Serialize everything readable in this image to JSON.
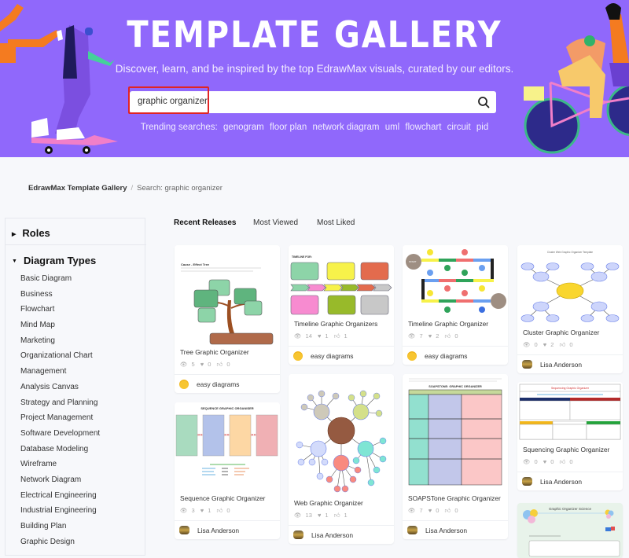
{
  "hero": {
    "title": "TEMPLATE GALLERY",
    "subtitle": "Discover, learn, and be inspired by the top EdrawMax visuals, curated by our editors.",
    "search_value": "graphic organizer",
    "search_icon": "search-icon",
    "trending_label": "Trending searches:",
    "trending": [
      "genogram",
      "floor plan",
      "network diagram",
      "uml",
      "flowchart",
      "circuit",
      "pid"
    ],
    "bg_color": "#9068fb"
  },
  "breadcrumb": {
    "root": "EdrawMax Template Gallery",
    "separator": "/",
    "current": "Search:  graphic organizer"
  },
  "sidebar": {
    "roles_label": "Roles",
    "diagram_types_label": "Diagram Types",
    "items": [
      "Basic Diagram",
      "Business",
      "Flowchart",
      "Mind Map",
      "Marketing",
      "Organizational Chart",
      "Management",
      "Analysis Canvas",
      "Strategy and Planning",
      "Project Management",
      "Software Development",
      "Database Modeling",
      "Wireframe",
      "Network Diagram",
      "Electrical Engineering",
      "Industrial Engineering",
      "Building Plan",
      "Graphic Design"
    ]
  },
  "tabs": [
    {
      "label": "Recent Releases",
      "active": true
    },
    {
      "label": "Most Viewed",
      "active": false
    },
    {
      "label": "Most Liked",
      "active": false
    }
  ],
  "cards": [
    {
      "title": "Tree Graphic Organizer",
      "views": "5",
      "favorites": "0",
      "likes": "0",
      "author": "easy diagrams"
    },
    {
      "title": "Timeline Graphic Organizers",
      "views": "14",
      "favorites": "1",
      "likes": "1",
      "author": "easy diagrams"
    },
    {
      "title": "Timeline Graphic Organizer",
      "views": "7",
      "favorites": "2",
      "likes": "0",
      "author": "easy diagrams"
    },
    {
      "title": "Cluster Graphic Organizer",
      "views": "0",
      "favorites": "2",
      "likes": "0",
      "author": "Lisa Anderson"
    },
    {
      "title": "Sequence Graphic Organizer",
      "views": "3",
      "favorites": "1",
      "likes": "0",
      "author": "Lisa Anderson"
    },
    {
      "title": "Web Graphic Organizer",
      "views": "13",
      "favorites": "1",
      "likes": "1",
      "author": "Lisa Anderson"
    },
    {
      "title": "SOAPSTone Graphic Organizer",
      "views": "7",
      "favorites": "0",
      "likes": "0",
      "author": "Lisa Anderson"
    },
    {
      "title": "Squencing Graphic Organizer",
      "views": "0",
      "favorites": "0",
      "likes": "0",
      "author": "Lisa Anderson"
    }
  ],
  "thumb_text": {
    "sequence_heading": "SEQUENCE GRAPHIC ORGANISER",
    "soapstone_heading": "SOAPSTONE: GRAPHIC ORGANIZER",
    "sequencing_heading": "Sequencing Graphic Organizer",
    "science_heading": "Graphic Organizer Science",
    "cluster_heading": "Cluster Web Graphic Organizer Template",
    "tree_heading": "Cause - Effect Tree",
    "timeline_heading": "TIMELINE FOR:",
    "timeline_start": "START"
  }
}
